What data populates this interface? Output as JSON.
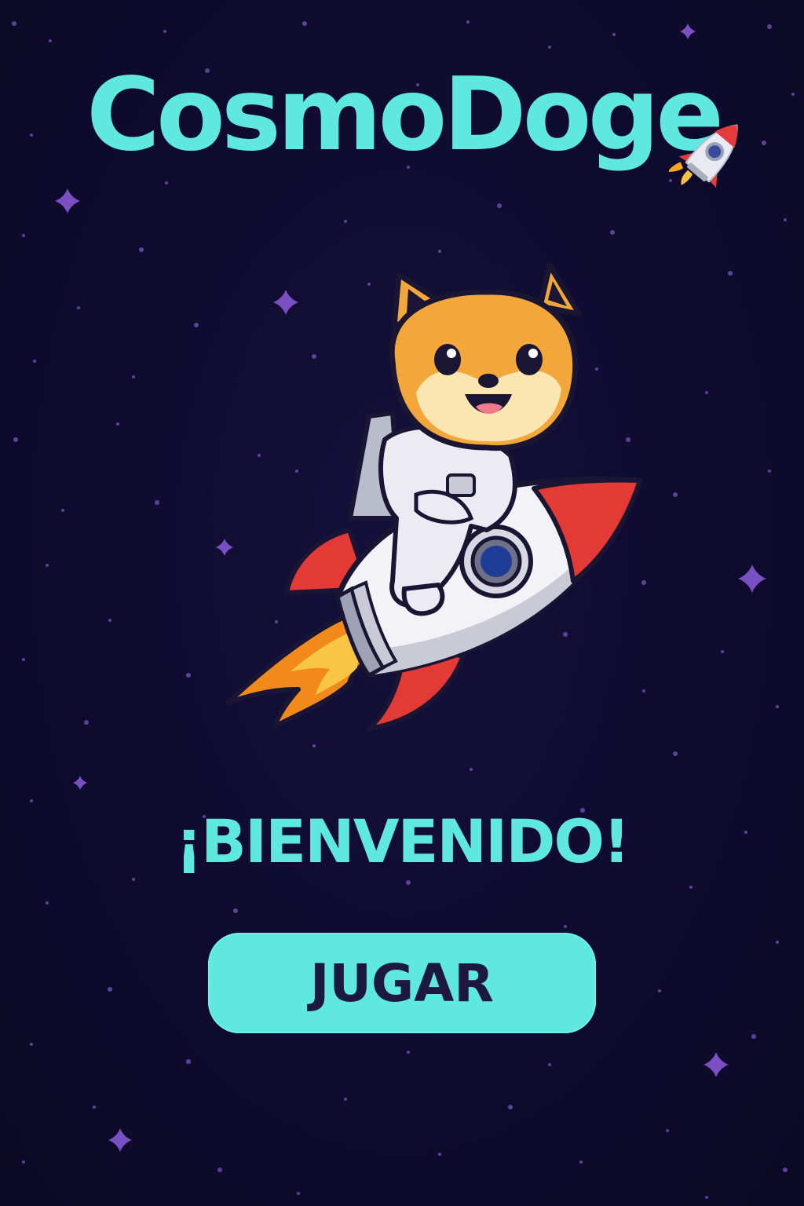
{
  "game": {
    "title": "CosmoDoge",
    "title_icon": "rocket-icon",
    "mascot": "shiba-astronaut-riding-rocket",
    "welcome_text": "¡BIENVENIDO!",
    "play_label": "JUGAR"
  },
  "colors": {
    "background": "#0f0b2e",
    "accent": "#5ee8e0",
    "button_text": "#1d1840",
    "star_sparkle": "#7a4fc4",
    "star_dot": "#6b4bb0"
  }
}
